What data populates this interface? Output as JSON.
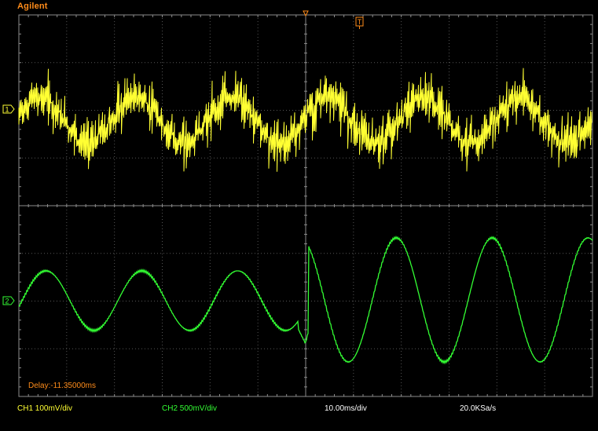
{
  "brand": "Agilent",
  "markers": {
    "ch1": "1",
    "ch2": "2",
    "trigger": "T"
  },
  "delay_text": "Delay:-11.35000ms",
  "status_bar": {
    "ch1_scale": "CH1 100mV/div",
    "ch2_scale": "CH2 500mV/div",
    "timebase": "10.00ms/div",
    "sample_rate": "20.0KSa/s"
  },
  "colors": {
    "ch1": "#ffff33",
    "ch2": "#33ff33",
    "accent": "#ff8c1a",
    "grid": "#8c8c8c"
  },
  "chart_data": {
    "type": "line",
    "grid": true,
    "series": [
      {
        "name": "CH1",
        "color": "#ffff33",
        "description_visible": "stepped multilevel PWM waveform, yellow, upper half"
      },
      {
        "name": "CH2",
        "color": "#33ff33",
        "description_visible": "sinusoid, green, lower half; amplitude increases after the centre of the screen"
      }
    ]
  }
}
